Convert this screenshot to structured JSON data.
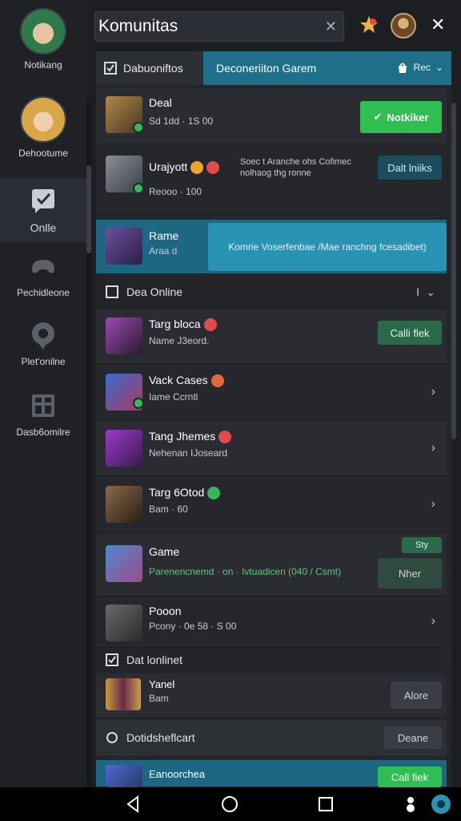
{
  "search": {
    "value": "Komunitas"
  },
  "sidebar": {
    "items": [
      {
        "label": "Notikang"
      },
      {
        "label": "Dehootume"
      },
      {
        "label": "Onlle"
      },
      {
        "label": "Pechidleone"
      },
      {
        "label": "Plet'onilne"
      },
      {
        "label": "Dasb6omilre"
      }
    ]
  },
  "tabs": {
    "left": "Dabuoniftos",
    "right": "Deconeriiton Garem",
    "right_action": "Rec"
  },
  "rows": [
    {
      "title": "Deal",
      "sub": "Sd 1dd · 1S 00",
      "button": "Notkiker"
    },
    {
      "title": "Urajyott",
      "sub": "Reooo · 100",
      "desc1": "Soec t Aranche ohs Cofimec",
      "desc2": "nolhaog thg ronne",
      "button": "Dalt lniiks"
    },
    {
      "title": "Rame",
      "sub": "Araa d",
      "button": "Komrie Voserfenbae /Mae ranchng fcesadibet)"
    }
  ],
  "section1": {
    "label": "Dea Online",
    "marker": "I"
  },
  "rows2": [
    {
      "title": "Targ bloca",
      "sub": "Name J3eord.",
      "button": "Calli flek"
    },
    {
      "title": "Vack Cases",
      "sub": "Iame Ccrntl"
    },
    {
      "title": "Tang Jhemes",
      "sub": "Nehenan IJoseard"
    },
    {
      "title": "Targ 6Otod",
      "sub": "Bam · 60"
    },
    {
      "title": "Game",
      "sub": "Parenencnemd · on · Ivtuadicen (040 / Csmt)",
      "tag": "Sty",
      "button": "Nher"
    },
    {
      "title": "Pooon",
      "sub": "Pcony · 0e 58 · S 00"
    }
  ],
  "section2": {
    "label": "Dat lonlinet"
  },
  "row_yanel": {
    "title": "Yanel",
    "sub": "Bam",
    "button": "Alore"
  },
  "section3": {
    "label": "Dotidsheflcart",
    "button": "Deane"
  },
  "row_last": {
    "title": "Eanoorchea",
    "button": "Call fiek"
  },
  "colors": {
    "accent": "#1f6e8a",
    "green": "#2fbe52",
    "bg": "#1c1e22"
  }
}
